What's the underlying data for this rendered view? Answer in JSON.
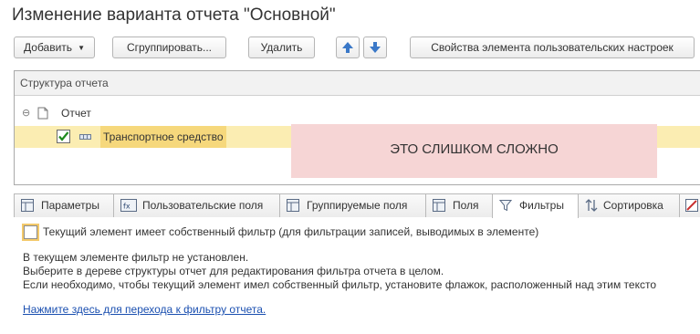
{
  "window": {
    "title": "Изменение варианта отчета \"Основной\""
  },
  "toolbar": {
    "add_label": "Добавить",
    "group_label": "Сгруппировать...",
    "delete_label": "Удалить",
    "properties_label": "Свойства элемента пользовательских настроек",
    "accent_color": "#3a78c8"
  },
  "structure": {
    "header": "Структура отчета",
    "root_label": "Отчет",
    "child_label": "Транспортное средство",
    "child_checked": true
  },
  "overlay": {
    "text": "ЭТО СЛИШКОМ СЛОЖНО",
    "color": "#f6d5d5"
  },
  "tabs": {
    "params": "Параметры",
    "user_fields": "Пользовательские поля",
    "grouped_fields": "Группируемые поля",
    "fields": "Поля",
    "filters": "Фильтры",
    "sort": "Сортировка",
    "active": "Фильтры"
  },
  "filter_panel": {
    "own_filter_label": "Текущий элемент имеет собственный фильтр (для фильтрации записей, выводимых в элементе)",
    "own_filter_checked": false,
    "info_line1": "В текущем элементе фильтр не установлен.",
    "info_line2": "Выберите в дереве структуры отчет для редактирования фильтра отчета в целом.",
    "info_line3": "Если необходимо, чтобы текущий элемент имел собственный фильтр, установите флажок, расположенный над этим тексто",
    "link_text": "Нажмите здесь для перехода к фильтру отчета."
  }
}
